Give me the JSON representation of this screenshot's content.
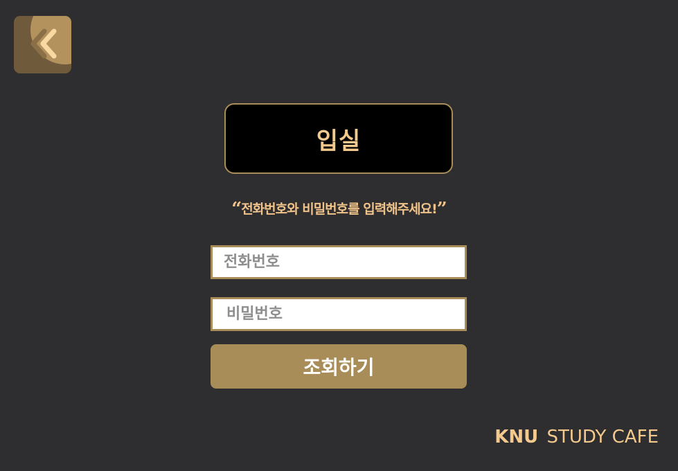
{
  "back_button": {
    "icon": "double-chevron-left-icon"
  },
  "header": {
    "title": "입실"
  },
  "instruction": {
    "open_quote": "“",
    "text": "전화번호와 비밀번호를 입력해주세요!",
    "close_quote": "”"
  },
  "form": {
    "phone_placeholder": "전화번호",
    "phone_value": "",
    "password_placeholder": "비밀번호",
    "password_value": "",
    "submit_label": "조회하기"
  },
  "brand": {
    "primary": "KNU",
    "secondary": "STUDY CAFE"
  },
  "colors": {
    "background": "#2e2d2f",
    "accent": "#a98d58",
    "highlight_text": "#f3c98d",
    "title_box": "#000000",
    "input_bg": "#ffffff"
  }
}
